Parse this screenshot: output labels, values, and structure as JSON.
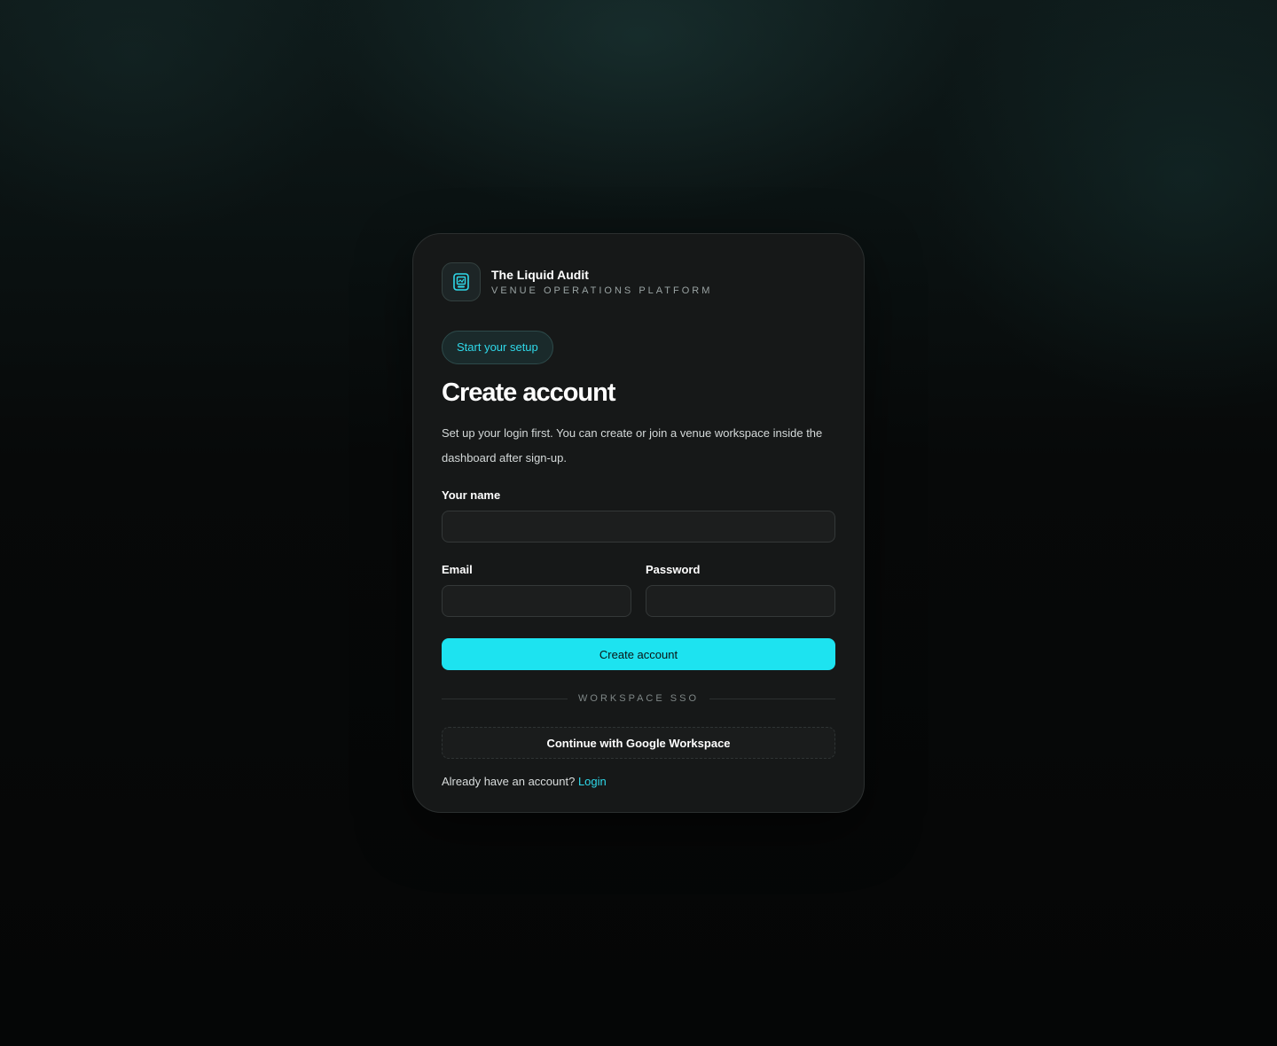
{
  "brand": {
    "name": "The Liquid Audit",
    "subtitle": "VENUE OPERATIONS PLATFORM",
    "logo_icon": "glass-audit-icon"
  },
  "badge": "Start your setup",
  "title": "Create account",
  "description": "Set up your login first. You can create or join a venue workspace inside the dashboard after sign-up.",
  "form": {
    "name_label": "Your name",
    "name_value": "",
    "email_label": "Email",
    "email_value": "",
    "password_label": "Password",
    "password_value": "",
    "submit_label": "Create account"
  },
  "divider_label": "WORKSPACE SSO",
  "sso_label": "Continue with Google Workspace",
  "footer": {
    "prompt": "Already have an account?",
    "link_label": "Login"
  },
  "colors": {
    "accent": "#1de3f0",
    "card": "#161818",
    "background": "#060707"
  }
}
